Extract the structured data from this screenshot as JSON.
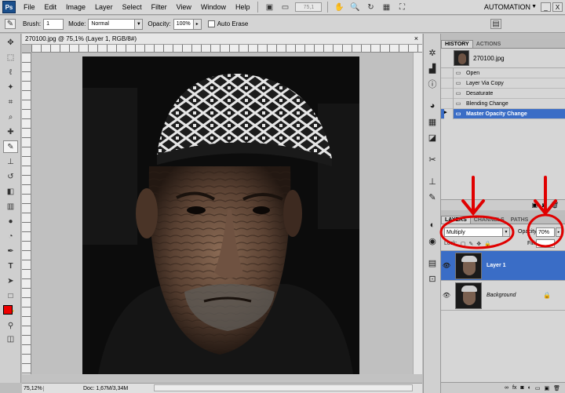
{
  "app": {
    "logo": "Ps",
    "workspace": "AUTOMATION"
  },
  "menu": [
    "File",
    "Edit",
    "Image",
    "Layer",
    "Select",
    "Filter",
    "View",
    "Window",
    "Help"
  ],
  "menubar": {
    "zoom": "75,1",
    "min": "_",
    "max": "□",
    "close": "X"
  },
  "options": {
    "brush_label": "Brush:",
    "brush_size": "1",
    "mode_label": "Mode:",
    "mode_value": "Normal",
    "opacity_label": "Opacity:",
    "opacity_value": "100%",
    "auto_erase": "Auto Erase"
  },
  "document": {
    "title": "270100.jpg @ 75,1% (Layer 1, RGB/8#)",
    "close": "×",
    "zoom": "75,12%",
    "doc_info": "Doc: 1,67M/3,34M"
  },
  "history": {
    "tabs": [
      "HISTORY",
      "ACTIONS"
    ],
    "snapshot": "270100.jpg",
    "items": [
      "Open",
      "Layer Via Copy",
      "Desaturate",
      "Blending Change",
      "Master Opacity Change"
    ],
    "selected_index": 4
  },
  "layers": {
    "tabs": [
      "LAYERS",
      "CHANNELS",
      "PATHS"
    ],
    "blend_mode": "Multiply",
    "opacity_label": "Opacity:",
    "opacity_value": "70%",
    "lock_label": "Lock:",
    "fill_label": "Fill:",
    "items": [
      {
        "name": "Layer 1",
        "selected": true
      },
      {
        "name": "Background",
        "selected": false
      }
    ]
  },
  "colors": {
    "selection": "#3a6dc6",
    "annotation": "#e00000",
    "foreground": "#e00000",
    "background": "#ffffff"
  }
}
